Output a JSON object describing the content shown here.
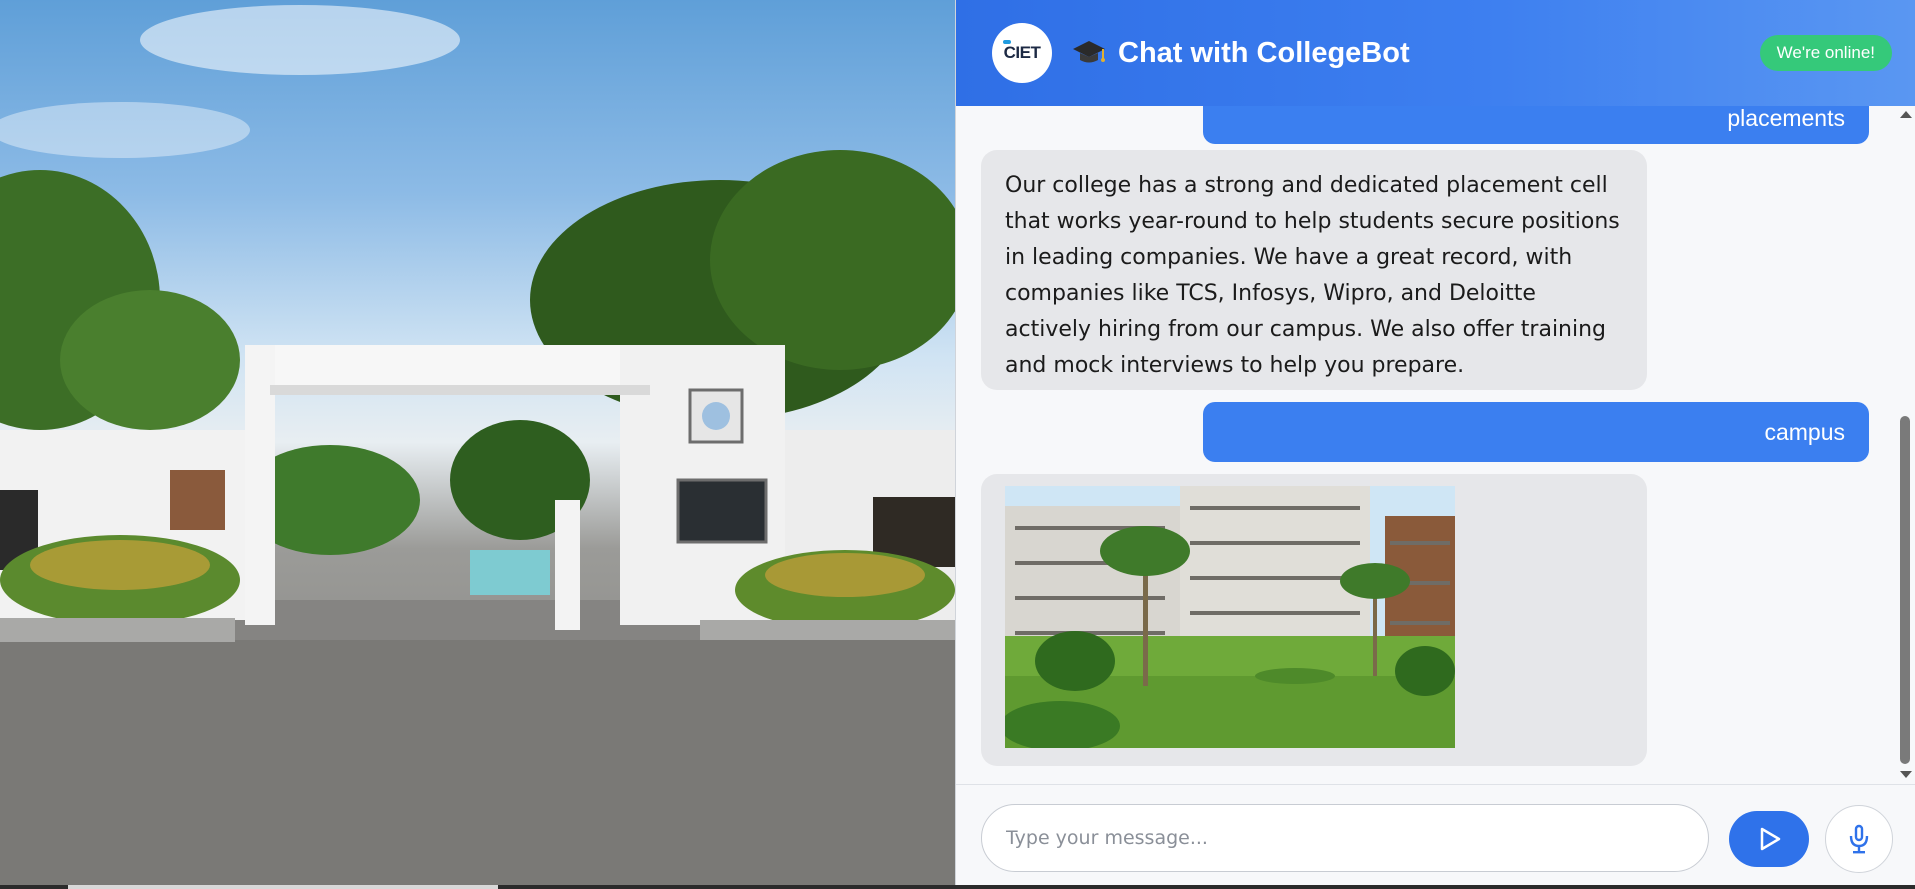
{
  "header": {
    "logo_text": "CIET",
    "title": "Chat with CollegeBot",
    "status_badge": "We're online!"
  },
  "messages": {
    "user_first": "placements",
    "bot_reply": "Our college has a strong and dedicated placement cell that works year-round to help students secure positions in leading companies. We have a great record, with companies like TCS, Infosys, Wipro, and Deloitte actively hiring from our campus. We also offer training and mock interviews to help you prepare.",
    "user_second": "campus"
  },
  "input": {
    "placeholder": "Type your message..."
  },
  "icons": {
    "header": "graduation-cap-icon",
    "send": "send-icon",
    "mic": "microphone-icon"
  },
  "colors": {
    "header_blue": "#2f6fe6",
    "user_bubble": "#3b7ff0",
    "bot_bubble": "#e6e7ea",
    "online_green": "#35c97a"
  }
}
